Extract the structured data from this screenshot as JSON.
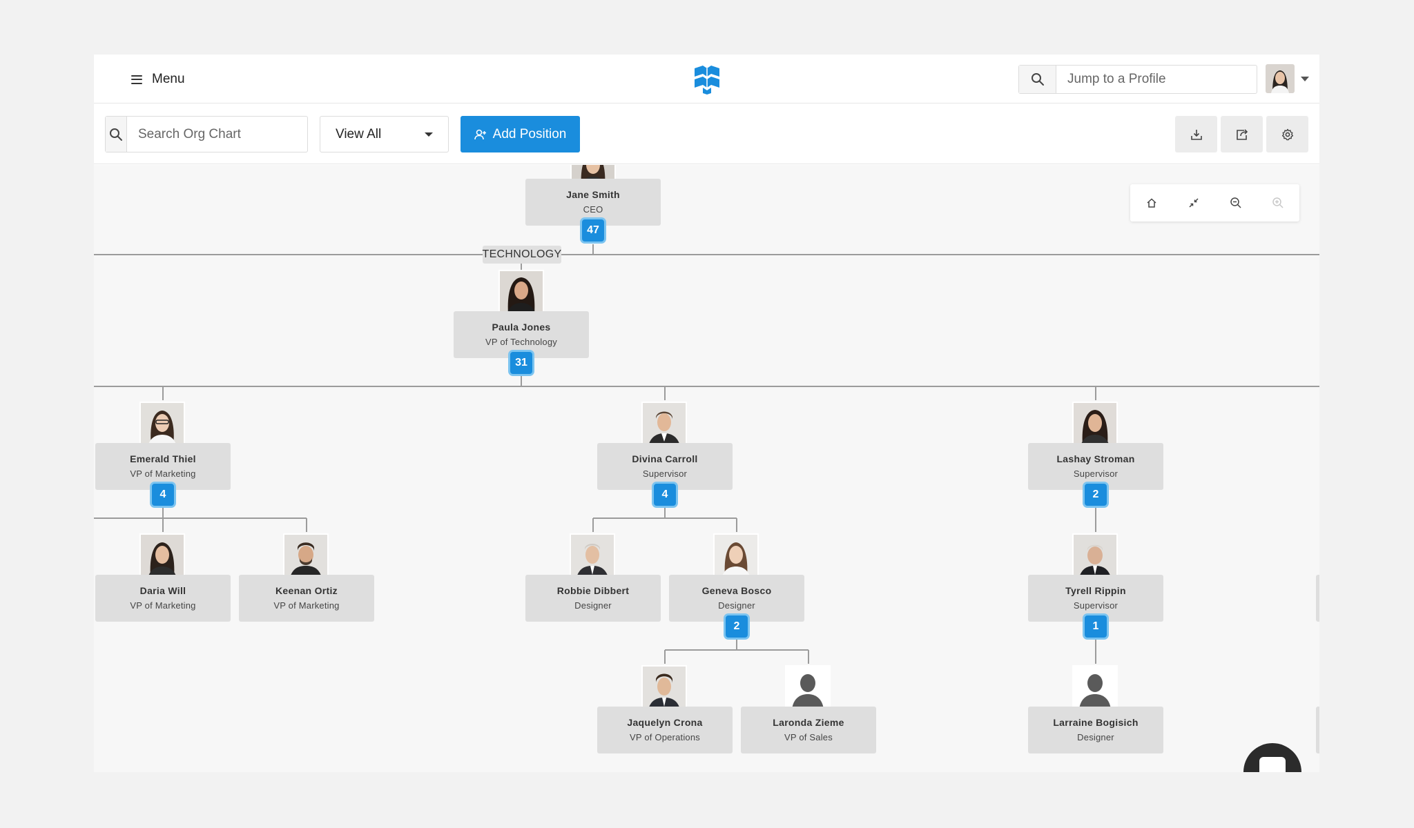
{
  "topbar": {
    "menu_label": "Menu",
    "jump_placeholder": "Jump to a Profile"
  },
  "toolbar": {
    "search_placeholder": "Search Org Chart",
    "view_select": "View All",
    "add_position_label": "Add Position"
  },
  "department": "TECHNOLOGY",
  "nodes": {
    "jane": {
      "name": "Jane Smith",
      "title": "CEO",
      "count": "47"
    },
    "paula": {
      "name": "Paula Jones",
      "title": "VP of Technology",
      "count": "31"
    },
    "emerald": {
      "name": "Emerald Thiel",
      "title": "VP of Marketing",
      "count": "4"
    },
    "divina": {
      "name": "Divina Carroll",
      "title": "Supervisor",
      "count": "4"
    },
    "lashay": {
      "name": "Lashay Stroman",
      "title": "Supervisor",
      "count": "2"
    },
    "daria": {
      "name": "Daria Will",
      "title": "VP of Marketing"
    },
    "keenan": {
      "name": "Keenan Ortiz",
      "title": "VP of Marketing"
    },
    "robbie": {
      "name": "Robbie Dibbert",
      "title": "Designer"
    },
    "geneva": {
      "name": "Geneva Bosco",
      "title": "Designer",
      "count": "2"
    },
    "tyrell": {
      "name": "Tyrell Rippin",
      "title": "Supervisor",
      "count": "1"
    },
    "jaquelyn": {
      "name": "Jaquelyn Crona",
      "title": "VP of Operations"
    },
    "laronda": {
      "name": "Laronda Zieme",
      "title": "VP of Sales"
    },
    "larraine": {
      "name": "Larraine Bogisich",
      "title": "Designer"
    }
  },
  "colors": {
    "accent": "#1a8ddd",
    "badge_border": "#7cc4f0",
    "card": "#dedede",
    "canvas": "#f7f7f7"
  },
  "icons": {
    "menu": "hamburger-icon",
    "logo": "brand-logo",
    "search": "search-icon",
    "add_position": "add-user-icon",
    "download": "download-icon",
    "share": "share-icon",
    "settings": "gear-icon",
    "home": "home-icon",
    "collapse": "collapse-icon",
    "zoom_out": "zoom-out-icon",
    "zoom_in": "zoom-in-icon"
  }
}
